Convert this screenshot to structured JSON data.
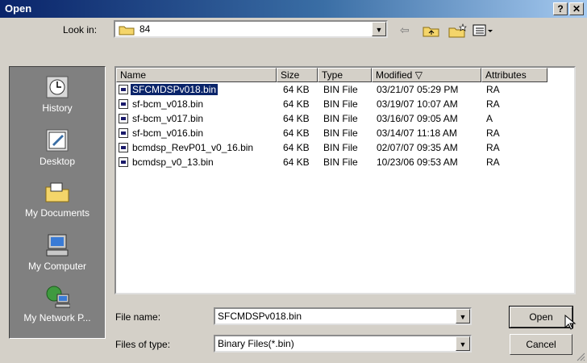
{
  "window": {
    "title": "Open",
    "help_label": "?",
    "close_label": "✕"
  },
  "look_in": {
    "label": "Look in:",
    "value": "84"
  },
  "places": [
    {
      "label": "History",
      "icon": "history-icon"
    },
    {
      "label": "Desktop",
      "icon": "desktop-icon"
    },
    {
      "label": "My Documents",
      "icon": "my-documents-icon"
    },
    {
      "label": "My Computer",
      "icon": "my-computer-icon"
    },
    {
      "label": "My Network P...",
      "icon": "my-network-places-icon"
    }
  ],
  "columns": {
    "name": "Name",
    "size": "Size",
    "type": "Type",
    "modified": "Modified ▽",
    "attributes": "Attributes"
  },
  "files": [
    {
      "name": "SFCMDSPv018.bin",
      "size": "64 KB",
      "type": "BIN File",
      "modified": "03/21/07 05:29 PM",
      "attributes": "RA"
    },
    {
      "name": "sf-bcm_v018.bin",
      "size": "64 KB",
      "type": "BIN File",
      "modified": "03/19/07 10:07 AM",
      "attributes": "RA"
    },
    {
      "name": "sf-bcm_v017.bin",
      "size": "64 KB",
      "type": "BIN File",
      "modified": "03/16/07 09:05 AM",
      "attributes": "A"
    },
    {
      "name": "sf-bcm_v016.bin",
      "size": "64 KB",
      "type": "BIN File",
      "modified": "03/14/07 11:18 AM",
      "attributes": "RA"
    },
    {
      "name": "bcmdsp_RevP01_v0_16.bin",
      "size": "64 KB",
      "type": "BIN File",
      "modified": "02/07/07 09:35 AM",
      "attributes": "RA"
    },
    {
      "name": "bcmdsp_v0_13.bin",
      "size": "64 KB",
      "type": "BIN File",
      "modified": "10/23/06 09:53 AM",
      "attributes": "RA"
    }
  ],
  "file_name": {
    "label": "File name:",
    "value": "SFCMDSPv018.bin"
  },
  "file_type": {
    "label": "Files of type:",
    "value": "Binary Files(*.bin)"
  },
  "buttons": {
    "open": "Open",
    "cancel": "Cancel"
  },
  "colors": {
    "selection": "#0a246a",
    "dialog": "#d4d0c8",
    "title_start": "#0a246a"
  }
}
